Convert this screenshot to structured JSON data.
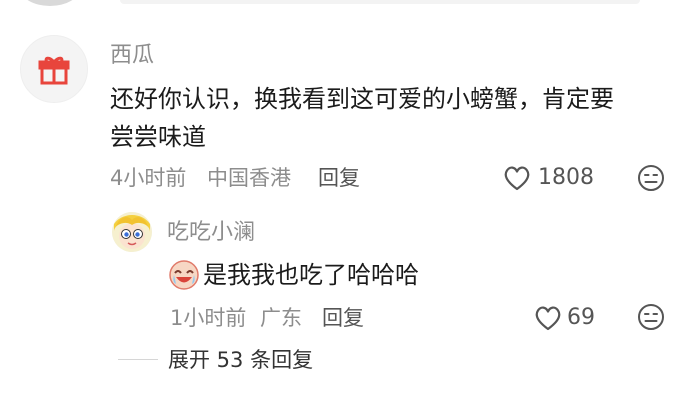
{
  "comment": {
    "username": "西瓜",
    "text_line1": "还好你认识，换我看到这可爱的小螃蟹，肯定要",
    "text_line2": "尝尝味道",
    "time": "4小时前",
    "location": "中国香港",
    "reply_label": "回复",
    "like_count": "1808"
  },
  "reply": {
    "username": "吃吃小澜",
    "text": "是我我也吃了哈哈哈",
    "time": "1小时前",
    "location": "广东",
    "reply_label": "回复",
    "like_count": "69"
  },
  "expand": {
    "label": "展开 53 条回复"
  },
  "colors": {
    "gift_red": "#e8453c",
    "meta_gray": "#8d8d8d",
    "text_dark": "#1b1b1b"
  }
}
